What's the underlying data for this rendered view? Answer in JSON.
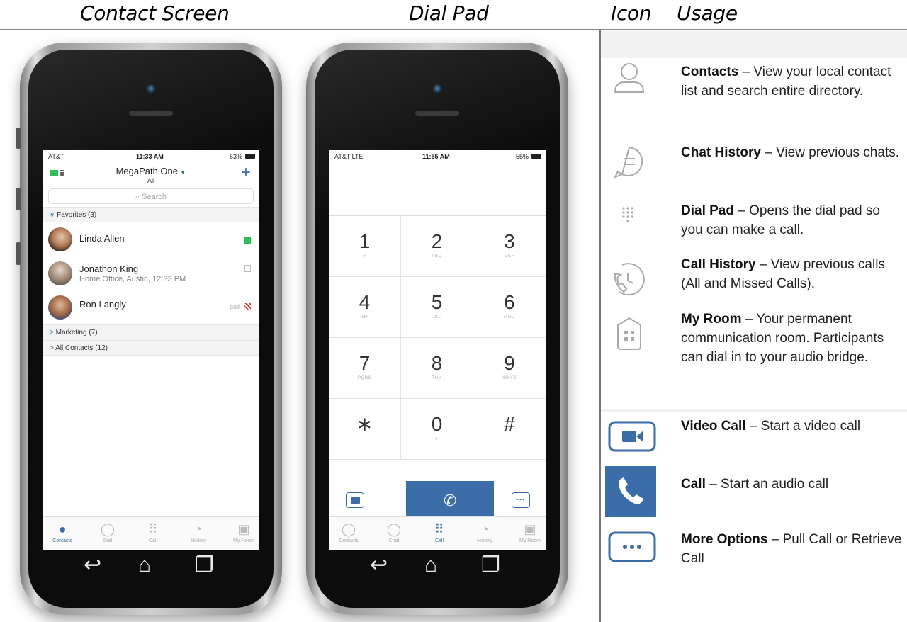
{
  "headers": {
    "contact_screen": "Contact Screen",
    "dial_pad": "Dial Pad",
    "icon": "Icon",
    "usage": "Usage"
  },
  "contact_phone": {
    "status": {
      "carrier": "AT&T",
      "time": "11:33 AM",
      "battery": "63%"
    },
    "title": "MegaPath One",
    "subtitle": "All",
    "add_symbol": "+",
    "search_placeholder": "Search",
    "favorites_label": "Favorites (3)",
    "contacts": [
      {
        "name": "Linda Allen",
        "sub": "",
        "status_color": "#2fbf5a"
      },
      {
        "name": "Jonathon King",
        "sub": "Home Office, Austin, 12:33 PM",
        "status_color": "#cccccc"
      },
      {
        "name": "Ron Langly",
        "sub": "",
        "status_text": "call",
        "status_color": "#e0483c"
      }
    ],
    "groups": [
      "Marketing (7)",
      "All Contacts (12)"
    ],
    "tabs": [
      "Contacts",
      "Dial",
      "Call",
      "History",
      "My Room"
    ]
  },
  "dial_phone": {
    "status": {
      "carrier": "AT&T LTE",
      "time": "11:55 AM",
      "battery": "55%"
    },
    "keys": [
      {
        "d": "1",
        "l": "∞"
      },
      {
        "d": "2",
        "l": "ABC"
      },
      {
        "d": "3",
        "l": "DEF"
      },
      {
        "d": "4",
        "l": "GHI"
      },
      {
        "d": "5",
        "l": "JKL"
      },
      {
        "d": "6",
        "l": "MNO"
      },
      {
        "d": "7",
        "l": "PQRS"
      },
      {
        "d": "8",
        "l": "TUV"
      },
      {
        "d": "9",
        "l": "WXYZ"
      },
      {
        "d": "∗",
        "l": ""
      },
      {
        "d": "0",
        "l": "+"
      },
      {
        "d": "#",
        "l": ""
      }
    ],
    "tabs": [
      "Contacts",
      "Chat",
      "Call",
      "History",
      "My Room"
    ]
  },
  "usage": [
    {
      "title": "Contacts",
      "desc": " – View your local contact list and search entire directory.",
      "icon": "person-icon"
    },
    {
      "title": "Chat History",
      "desc": " – View previous chats.",
      "icon": "chat-icon"
    },
    {
      "title": "Dial Pad",
      "desc": " – Opens the dial pad so you can make a call.",
      "icon": "dialpad-icon"
    },
    {
      "title": "Call History",
      "desc": " – View previous calls (All and Missed Calls).",
      "icon": "call-history-icon"
    },
    {
      "title": "My Room",
      "desc": " – Your permanent communication room. Participants can dial in to your audio bridge.",
      "icon": "my-room-icon"
    },
    {
      "title": "Video Call",
      "desc": " – Start a video call",
      "icon": "video-camera-icon"
    },
    {
      "title": "Call",
      "desc": " – Start an audio call",
      "icon": "phone-handset-icon"
    },
    {
      "title": "More Options",
      "desc": " – Pull Call or Retrieve Call",
      "icon": "more-options-icon"
    }
  ],
  "colors": {
    "accent": "#3b6ea8",
    "online": "#2fbf5a",
    "busy": "#e0483c"
  }
}
